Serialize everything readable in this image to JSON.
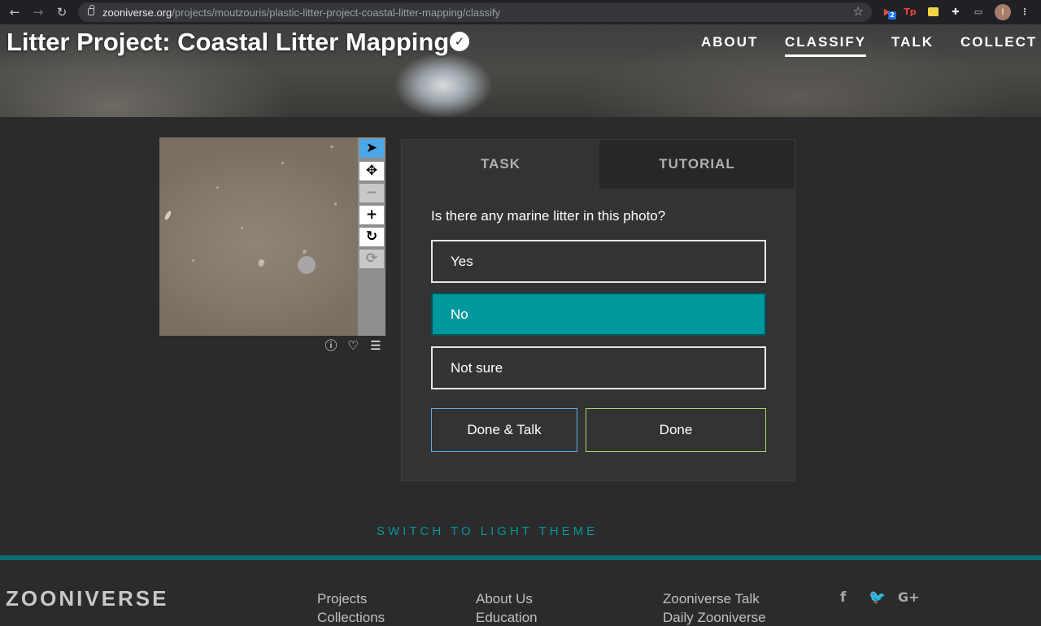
{
  "browser": {
    "url_host": "zooniverse.org",
    "url_path": "/projects/moutzouris/plastic-litter-project-coastal-litter-mapping/classify",
    "back_icon": "arrow-left-icon",
    "forward_icon": "arrow-right-icon",
    "reload_icon": "reload-icon",
    "extensions": [
      {
        "name": "video-extension-icon",
        "badge": "2",
        "color": "#e8453c"
      },
      {
        "name": "tp-extension-icon",
        "label": "Tp",
        "color": "#e8453c"
      },
      {
        "name": "notes-extension-icon",
        "color": "#f2d544"
      },
      {
        "name": "puzzle-icon",
        "color": "#c4c7c5"
      },
      {
        "name": "cast-icon",
        "color": "#c4c7c5"
      }
    ],
    "profile_initial": "I"
  },
  "header": {
    "title": "Litter Project: Coastal Litter Mapping",
    "nav": [
      {
        "label": "ABOUT",
        "active": false
      },
      {
        "label": "CLASSIFY",
        "active": true
      },
      {
        "label": "TALK",
        "active": false
      },
      {
        "label": "COLLECT",
        "active": false
      }
    ]
  },
  "viewer": {
    "tools": [
      "pointer-icon",
      "move-icon",
      "zoom-out-icon",
      "zoom-in-icon",
      "rotate-icon",
      "reset-icon"
    ],
    "selected_tool": "pointer-icon",
    "meta_icons": [
      "info-icon",
      "heart-icon",
      "list-icon"
    ]
  },
  "task_panel": {
    "tabs": [
      {
        "label": "TASK"
      },
      {
        "label": "TUTORIAL"
      }
    ],
    "question": "Is there any marine litter in this photo?",
    "answers": [
      {
        "label": "Yes",
        "checked": false
      },
      {
        "label": "No",
        "checked": true
      },
      {
        "label": "Not sure",
        "checked": false
      }
    ],
    "done_talk_label": "Done & Talk",
    "done_label": "Done"
  },
  "theme_switch": "SWITCH TO LIGHT THEME",
  "footer": {
    "logo": "ZOONIVERSE",
    "col1": [
      "Projects",
      "Collections"
    ],
    "col2": [
      "About Us",
      "Education"
    ],
    "col3": [
      "Zooniverse Talk",
      "Daily Zooniverse"
    ],
    "social": [
      "facebook-icon",
      "twitter-icon",
      "google-plus-icon"
    ],
    "colors": {
      "accent": "#00979d",
      "footer_bar": "#0b6e73"
    }
  }
}
